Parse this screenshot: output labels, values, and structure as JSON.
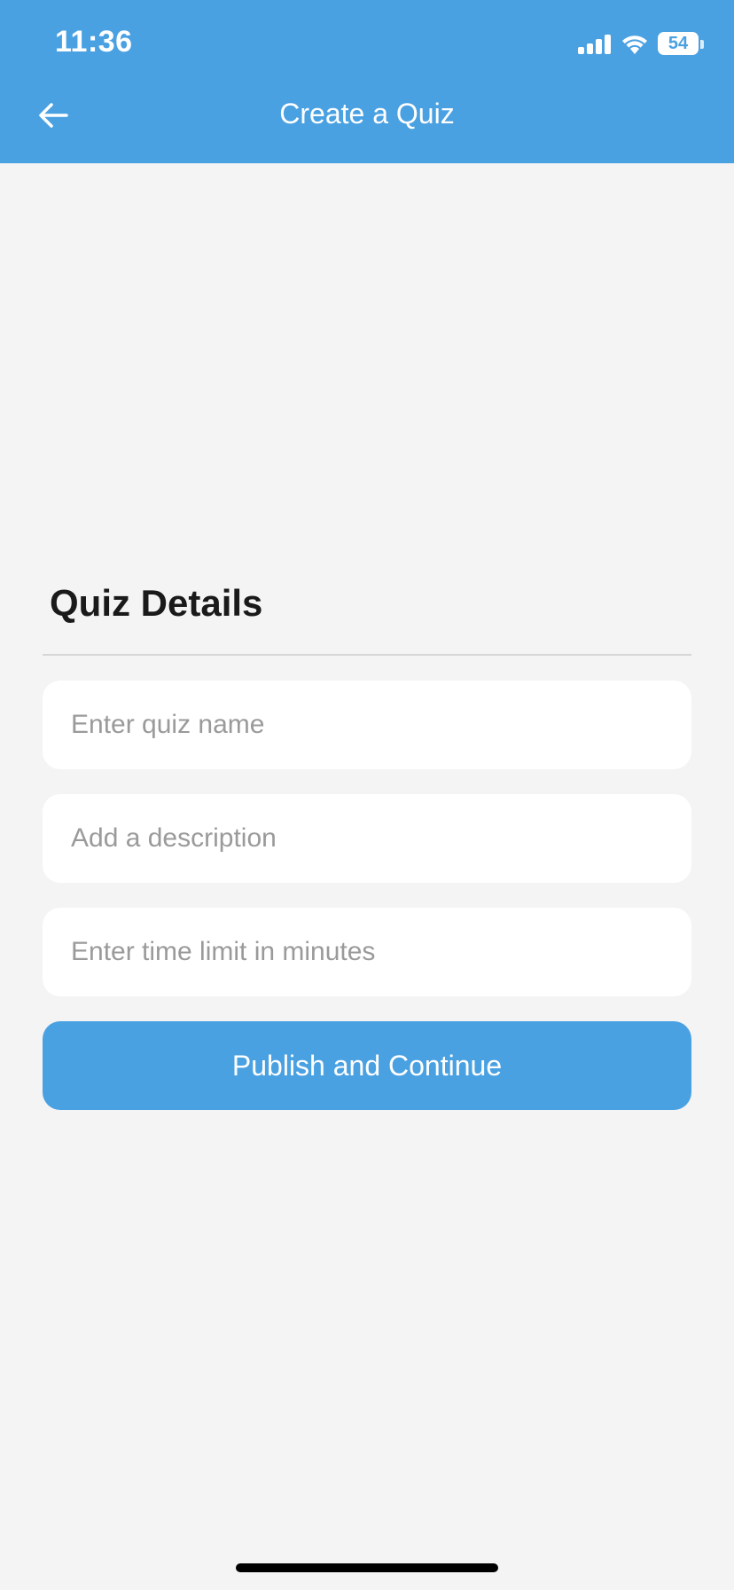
{
  "status_bar": {
    "time": "11:36",
    "battery_level": "54",
    "icons": [
      "signal-icon",
      "wifi-icon",
      "battery-icon"
    ]
  },
  "header": {
    "title": "Create a Quiz",
    "back_icon": "arrow-left-icon",
    "background_color": "#4aa1e2"
  },
  "form": {
    "section_title": "Quiz Details",
    "fields": {
      "quiz_name": {
        "placeholder": "Enter quiz name",
        "value": ""
      },
      "description": {
        "placeholder": "Add a description",
        "value": ""
      },
      "time_limit": {
        "placeholder": "Enter time limit in minutes",
        "value": ""
      }
    },
    "submit_label": "Publish and Continue"
  },
  "colors": {
    "accent": "#4aa1e2",
    "page_background": "#f4f4f4",
    "placeholder": "#9a9a9a"
  }
}
